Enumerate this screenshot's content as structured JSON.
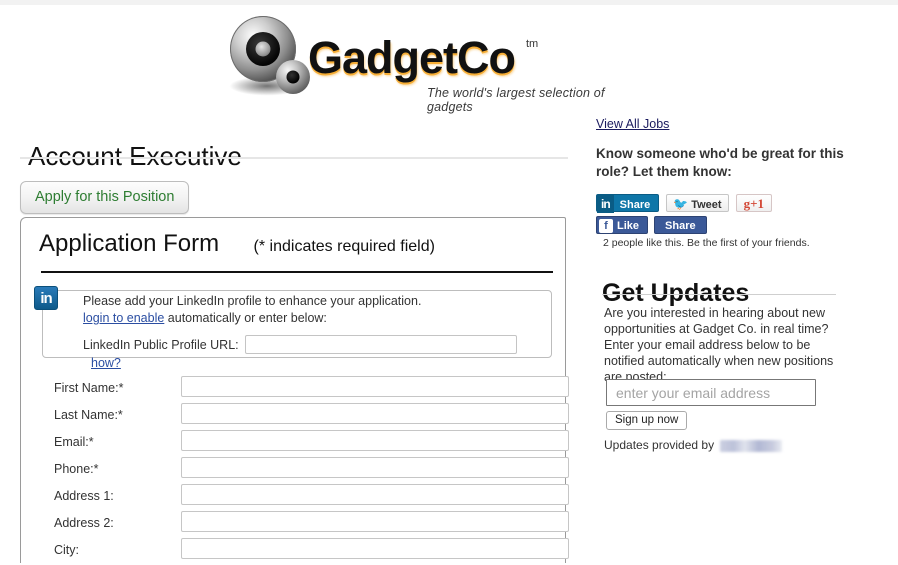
{
  "brand": {
    "name": "GadgetCo",
    "tm": "tm",
    "tagline": "The world's largest selection of gadgets",
    "logo_icon": "gears-icon",
    "accent_color": "#f5a623"
  },
  "job": {
    "title": "Account Executive",
    "apply_button": "Apply for this Position"
  },
  "form": {
    "heading": "Application Form",
    "required_note": "(* indicates required field)",
    "linkedin": {
      "icon": "linkedin-icon",
      "line1": "Please add your LinkedIn profile to enhance your application.",
      "login_link": "login to enable",
      "line2_rest": " automatically or enter below:",
      "url_label": "LinkedIn Public Profile URL:",
      "url_value": "",
      "how_link": "how?"
    },
    "fields": [
      {
        "label": "First Name:*",
        "value": ""
      },
      {
        "label": "Last Name:*",
        "value": ""
      },
      {
        "label": "Email:*",
        "value": ""
      },
      {
        "label": "Phone:*",
        "value": ""
      },
      {
        "label": "Address 1:",
        "value": ""
      },
      {
        "label": "Address 2:",
        "value": ""
      },
      {
        "label": "City:",
        "value": ""
      }
    ]
  },
  "sidebar": {
    "view_all_jobs": "View All Jobs",
    "referral_prompt": "Know someone who'd be great for this role? Let them know:",
    "social": {
      "linkedin_icon": "in",
      "linkedin_share": "Share",
      "twitter_icon": "twitter-bird-icon",
      "twitter_label": "Tweet",
      "googleplus_label": "g+1",
      "facebook_icon": "f",
      "facebook_like": "Like",
      "facebook_share": "Share",
      "facebook_note": "2 people like this. Be the first of your friends."
    },
    "updates": {
      "heading": "Get Updates",
      "body": "Are you interested in hearing about new opportunities at Gadget Co. in real time? Enter your email address below to be notified automatically when new positions are posted:",
      "email_placeholder": "enter your email address",
      "email_value": "",
      "signup_button": "Sign up now",
      "provided_by": "Updates provided by"
    }
  }
}
